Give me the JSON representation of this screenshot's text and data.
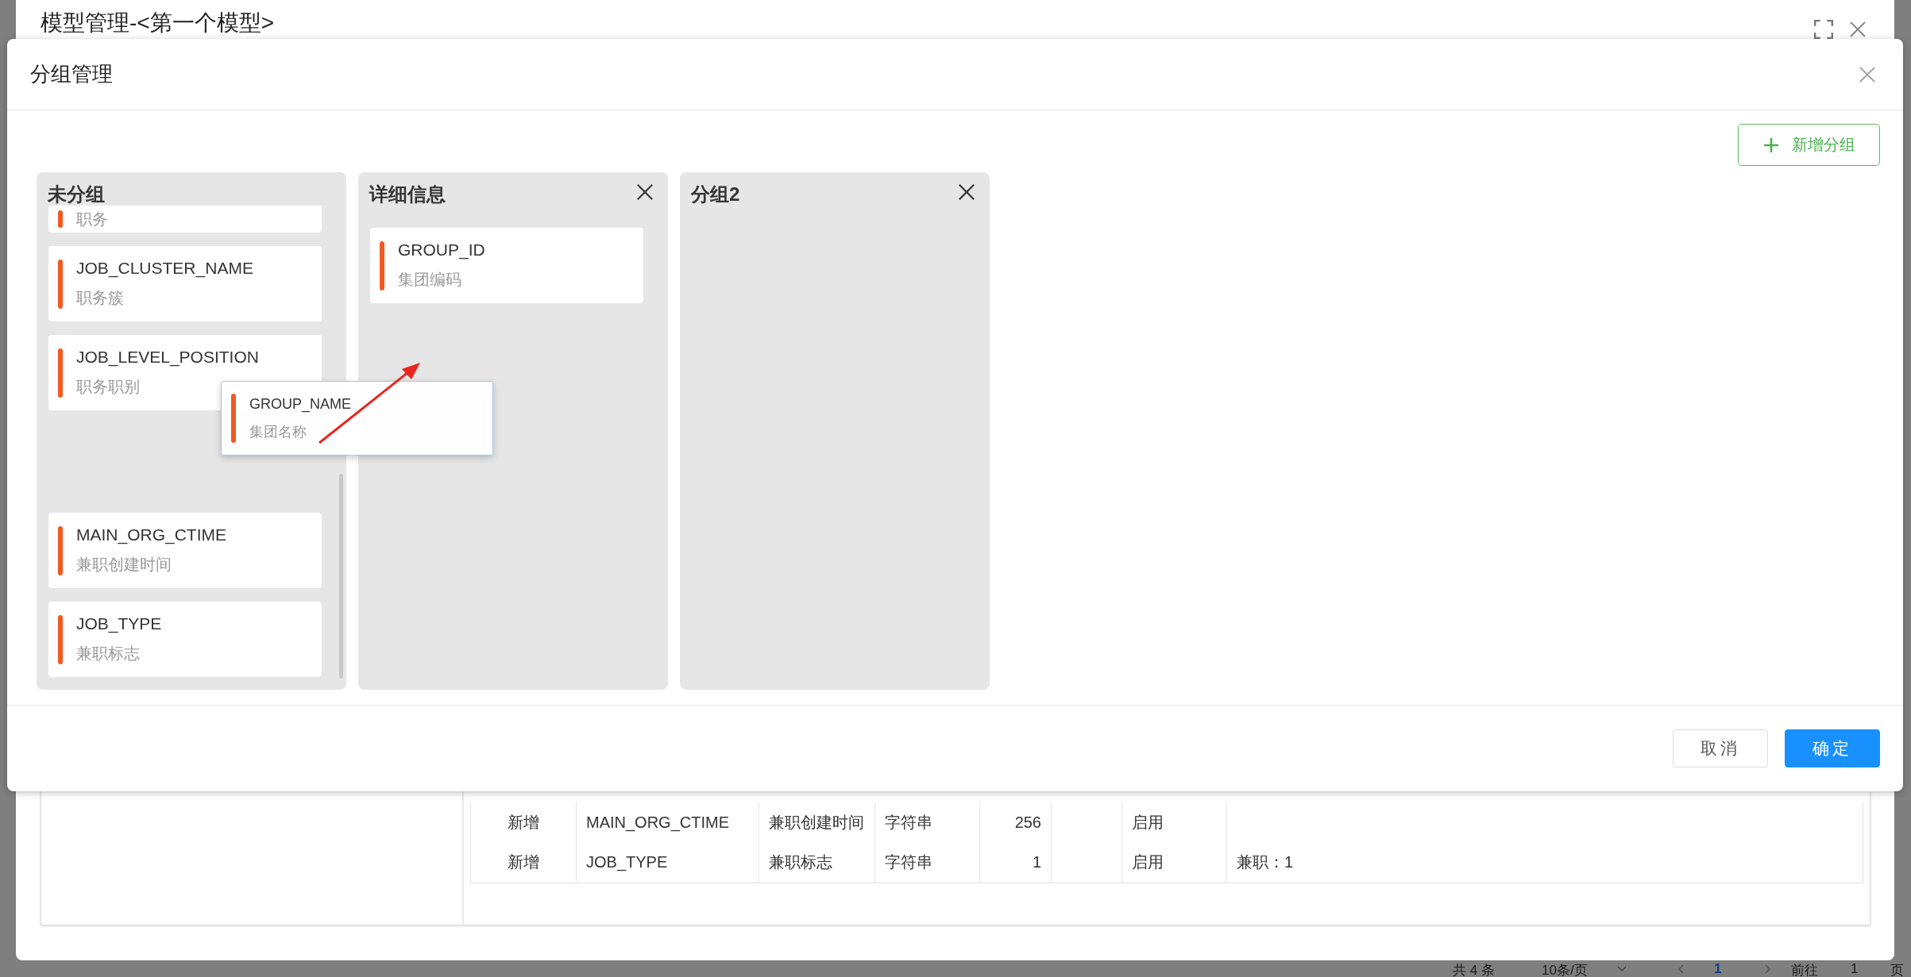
{
  "outer_dialog": {
    "title": "模型管理-<第一个模型>",
    "table": {
      "rows": [
        {
          "cells": [
            "新增",
            "MAIN_ORG_CTIME",
            "兼职创建时间",
            "字符串",
            "256",
            "",
            "启用",
            ""
          ]
        },
        {
          "cells": [
            "新增",
            "JOB_TYPE",
            "兼职标志",
            "字符串",
            "1",
            "",
            "启用",
            "兼职：1"
          ]
        }
      ]
    },
    "pagination": {
      "total": "共 4 条",
      "page_size": "10条/页",
      "current_page": "1",
      "goto_label": "前往",
      "goto_value": "1",
      "page_unit": "页"
    }
  },
  "dialog": {
    "title": "分组管理",
    "add_button": "新增分组",
    "groups": [
      {
        "name": "未分组",
        "closable": false,
        "items": [
          {
            "kind": "partial",
            "label": "职务"
          },
          {
            "kind": "field",
            "code": "JOB_CLUSTER_NAME",
            "label": "职务簇"
          },
          {
            "kind": "field",
            "code": "JOB_LEVEL_POSITION",
            "label": "职务职别"
          },
          {
            "kind": "slot"
          },
          {
            "kind": "field",
            "code": "MAIN_ORG_CTIME",
            "label": "兼职创建时间"
          },
          {
            "kind": "field",
            "code": "JOB_TYPE",
            "label": "兼职标志"
          }
        ]
      },
      {
        "name": "详细信息",
        "closable": true,
        "items": [
          {
            "kind": "field",
            "code": "GROUP_ID",
            "label": "集团编码"
          }
        ]
      },
      {
        "name": "分组2",
        "closable": true
      }
    ],
    "dragging": {
      "code": "GROUP_NAME",
      "label": "集团名称"
    },
    "buttons": [
      {
        "label": "取消",
        "kind": "default"
      },
      {
        "label": "确定",
        "kind": "primary"
      }
    ]
  }
}
